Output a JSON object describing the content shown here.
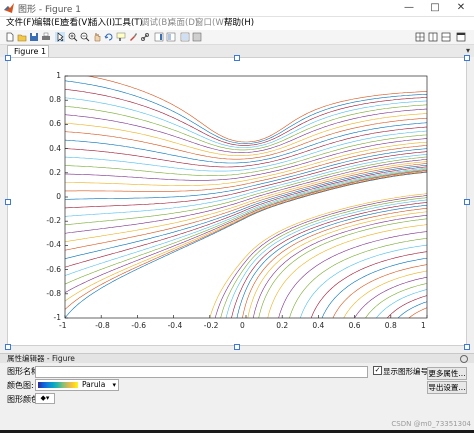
{
  "window": {
    "title": "图形 - Figure 1",
    "min_glyph": "—",
    "max_glyph": "□",
    "close_glyph": "✕"
  },
  "menu": [
    "文件(F)",
    "编辑(E)",
    "查看(V)",
    "插入(I)",
    "工具(T)",
    "调试(B)",
    "桌面(D)",
    "窗口(W)",
    "帮助(H)"
  ],
  "toolbar_icons": [
    "new-icon",
    "open-icon",
    "save-icon",
    "print-icon",
    "arrow-icon",
    "zoom-in-icon",
    "zoom-out-icon",
    "pan-icon",
    "rotate-icon",
    "data-cursor-icon",
    "brush-icon",
    "link-icon",
    "colorbar-icon",
    "legend-icon",
    "hide-plot-tools-icon",
    "show-plot-tools-icon",
    "tile-icon",
    "grid-layout-icon",
    "layout-icon",
    "dock-icon"
  ],
  "tab": {
    "label": "Figure 1",
    "arrow": "▾"
  },
  "chart_data": {
    "type": "line",
    "description_of_content": "streamlines",
    "title": "",
    "xlabel": "",
    "ylabel": "",
    "xlim": [
      -1,
      1
    ],
    "ylim": [
      -1,
      1
    ],
    "xticks": [
      "-1",
      "-0.8",
      "-0.6",
      "-0.4",
      "-0.2",
      "0",
      "0.2",
      "0.4",
      "0.6",
      "0.8",
      "1"
    ],
    "yticks": [
      "1",
      "0.8",
      "0.6",
      "0.4",
      "0.2",
      "0",
      "-0.2",
      "-0.4",
      "-0.6",
      "-0.8",
      "-1"
    ],
    "grid": false,
    "legend": "none",
    "center": [
      0,
      0.55
    ],
    "colors": [
      "#0072BD",
      "#D95319",
      "#EDB120",
      "#7E2F8E",
      "#77AC30",
      "#4DBEEE",
      "#A2142F"
    ]
  },
  "property_editor": {
    "header": "属性编辑器 - Figure",
    "name_label": "图形名称:",
    "name_value": "",
    "show_number_label": "显示图形编号",
    "show_number_checked": "✓",
    "colormap_label": "颜色图:",
    "colormap_value": "Parula",
    "figure_color_label": "图形颜色:",
    "more_props_button": "更多属性...",
    "export_button": "导出设置..."
  },
  "watermark": "CSDN @m0_73351304"
}
